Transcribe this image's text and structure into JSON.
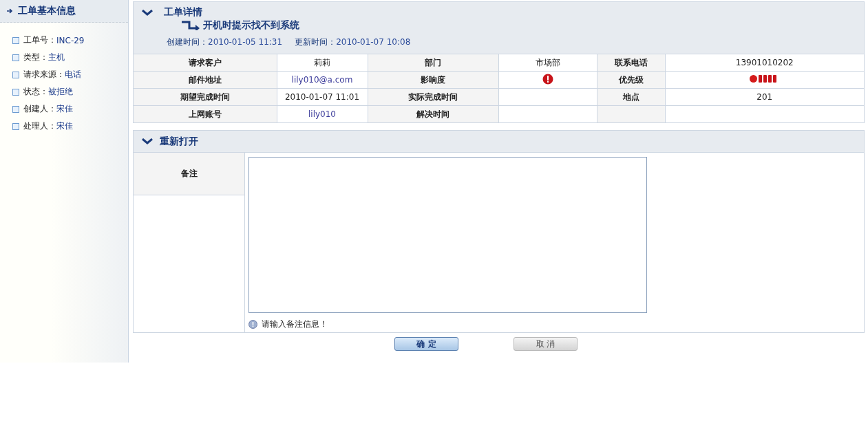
{
  "sidebar": {
    "title": "工单基本信息",
    "items": [
      {
        "label": "工单号：",
        "value": "INC-29"
      },
      {
        "label": "类型：",
        "value": "主机"
      },
      {
        "label": "请求来源：",
        "value": "电话"
      },
      {
        "label": "状态：",
        "value": "被拒绝"
      },
      {
        "label": "创建人：",
        "value": "宋佳"
      },
      {
        "label": "处理人：",
        "value": "宋佳"
      }
    ]
  },
  "detail": {
    "title": "工单详情",
    "subject": "开机时提示找不到系统",
    "created_label": "创建时间：",
    "created": "2010-01-05 11:31",
    "updated_label": "更新时间：",
    "updated": "2010-01-07 10:08",
    "rows": [
      [
        {
          "kind": "label",
          "text": "请求客户"
        },
        {
          "kind": "value",
          "text": "莉莉"
        },
        {
          "kind": "label",
          "text": "部门"
        },
        {
          "kind": "value",
          "text": "市场部"
        },
        {
          "kind": "label",
          "text": "联系电话"
        },
        {
          "kind": "value",
          "text": "13901010202"
        }
      ],
      [
        {
          "kind": "label",
          "text": "邮件地址"
        },
        {
          "kind": "link",
          "text": "lily010@a.com"
        },
        {
          "kind": "label",
          "text": "影响度"
        },
        {
          "kind": "impact"
        },
        {
          "kind": "label",
          "text": "优先级"
        },
        {
          "kind": "priority"
        }
      ],
      [
        {
          "kind": "label",
          "text": "期望完成时间"
        },
        {
          "kind": "value",
          "text": "2010-01-07 11:01"
        },
        {
          "kind": "label",
          "text": "实际完成时间"
        },
        {
          "kind": "empty"
        },
        {
          "kind": "label",
          "text": "地点"
        },
        {
          "kind": "value",
          "text": "201"
        }
      ],
      [
        {
          "kind": "label",
          "text": "上网账号"
        },
        {
          "kind": "link",
          "text": "lily010"
        },
        {
          "kind": "label",
          "text": "解决时间"
        },
        {
          "kind": "empty"
        },
        {
          "kind": "blank-label"
        },
        {
          "kind": "empty"
        }
      ]
    ]
  },
  "reopen": {
    "title": "重新打开",
    "note_label": "备注",
    "hint": "请输入备注信息！"
  },
  "buttons": [
    {
      "label": "确 定",
      "kind": "primary"
    },
    {
      "label": "取 消",
      "kind": "secondary"
    }
  ]
}
